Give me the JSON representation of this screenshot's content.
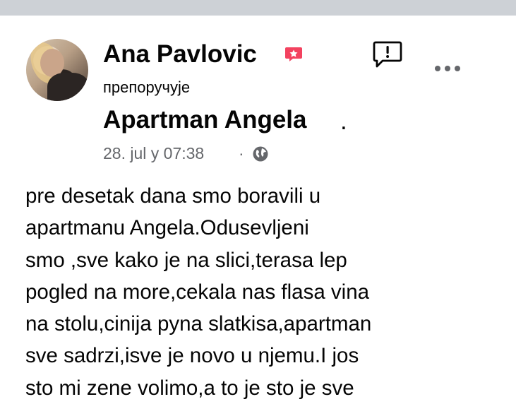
{
  "post": {
    "author_name": "Ana Pavlovic",
    "action_text": "препоручује",
    "page_name": "Apartman Angela",
    "page_suffix": ".",
    "timestamp": "28. jul y 07:38",
    "separator": "·",
    "privacy_icon": "globe-icon",
    "badge_icon": "recommend-badge-icon",
    "report_icon": "report-icon",
    "more_icon": "more-options-icon",
    "body_lines": [
      "pre desetak dana smo boravili u",
      "apartmanu Angela.Odusevljeni",
      "smo ,sve kako je na slici,terasa lep",
      "pogled na more,cekala nas flasa vina",
      "na stolu,cinija pyna slatkisa,apartman",
      "sve sadrzi,isve je novo u njemu.I jos",
      "sto mi zene volimo,a to je sto je sve"
    ]
  },
  "colors": {
    "top_bar": "#cdd1d6",
    "text_primary": "#050505",
    "text_secondary": "#65676b",
    "badge": "#f3425f"
  }
}
